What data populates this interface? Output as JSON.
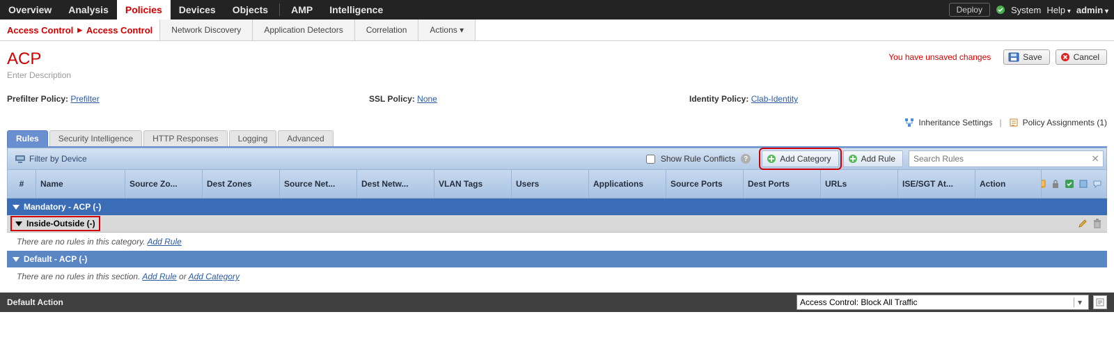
{
  "topnav": {
    "left": [
      "Overview",
      "Analysis",
      "Policies",
      "Devices",
      "Objects"
    ],
    "left2": [
      "AMP",
      "Intelligence"
    ],
    "active": "Policies",
    "deploy": "Deploy",
    "system": "System",
    "help": "Help",
    "user": "admin"
  },
  "breadcrumb": {
    "a": "Access Control",
    "b": "Access Control"
  },
  "subtabs": [
    "Network Discovery",
    "Application Detectors",
    "Correlation",
    "Actions ▾"
  ],
  "title": "ACP",
  "desc_placeholder": "Enter Description",
  "unsaved": "You have unsaved changes",
  "btn_save": "Save",
  "btn_cancel": "Cancel",
  "policies": {
    "prefilter_label": "Prefilter Policy:",
    "prefilter_value": "Prefilter",
    "ssl_label": "SSL Policy:",
    "ssl_value": "None",
    "identity_label": "Identity Policy:",
    "identity_value": "Clab-Identity"
  },
  "settings_links": {
    "inheritance": "Inheritance Settings",
    "assignments": "Policy Assignments (1)"
  },
  "lowtabs": [
    "Rules",
    "Security Intelligence",
    "HTTP Responses",
    "Logging",
    "Advanced"
  ],
  "lowtabs_active": "Rules",
  "toolbar": {
    "filter_by_device": "Filter by Device",
    "show_rule_conflicts": "Show Rule Conflicts",
    "add_category": "Add Category",
    "add_rule": "Add Rule",
    "search_placeholder": "Search Rules"
  },
  "columns": [
    "#",
    "Name",
    "Source Zo...",
    "Dest Zones",
    "Source Net...",
    "Dest Netw...",
    "VLAN Tags",
    "Users",
    "Applications",
    "Source Ports",
    "Dest Ports",
    "URLs",
    "ISE/SGT At...",
    "Action"
  ],
  "bands": {
    "mandatory": "Mandatory - ACP (-)",
    "category": "Inside-Outside (-)",
    "empty1_a": "There are no rules in this category. ",
    "empty1_link": "Add Rule",
    "default_band": "Default - ACP (-)",
    "empty2_a": "There are no rules in this section. ",
    "empty2_link1": "Add Rule",
    "empty2_or": " or ",
    "empty2_link2": "Add Category"
  },
  "default_action": {
    "label": "Default Action",
    "value": "Access Control: Block All Traffic"
  }
}
